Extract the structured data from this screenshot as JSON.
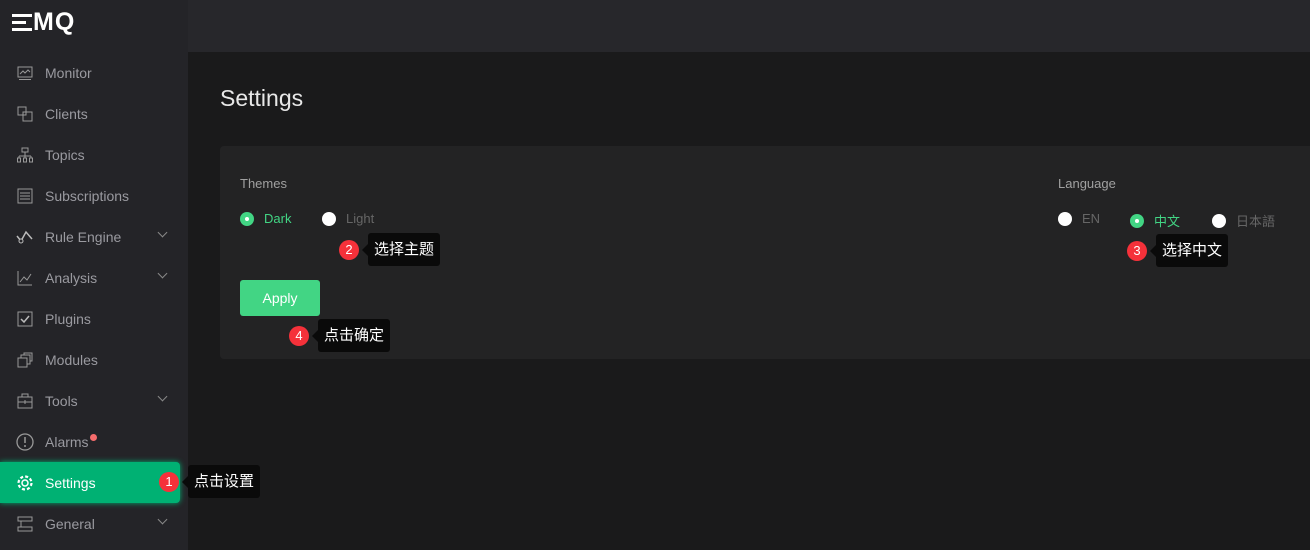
{
  "brand": {
    "logo": "EMQ"
  },
  "sidebar": {
    "items": [
      {
        "label": "Monitor",
        "icon": "monitor-icon"
      },
      {
        "label": "Clients",
        "icon": "clients-icon"
      },
      {
        "label": "Topics",
        "icon": "topics-icon"
      },
      {
        "label": "Subscriptions",
        "icon": "subscriptions-icon"
      },
      {
        "label": "Rule Engine",
        "icon": "rule-engine-icon",
        "expandable": true
      },
      {
        "label": "Analysis",
        "icon": "analysis-icon",
        "expandable": true
      },
      {
        "label": "Plugins",
        "icon": "plugins-icon"
      },
      {
        "label": "Modules",
        "icon": "modules-icon"
      },
      {
        "label": "Tools",
        "icon": "tools-icon",
        "expandable": true
      },
      {
        "label": "Alarms",
        "icon": "alarm-icon",
        "notification_dot": true
      },
      {
        "label": "Settings",
        "icon": "gear-icon",
        "active": true
      },
      {
        "label": "General",
        "icon": "general-icon",
        "expandable": true
      }
    ]
  },
  "page": {
    "title": "Settings"
  },
  "themes": {
    "label": "Themes",
    "options": [
      "Dark",
      "Light"
    ],
    "selected": "Dark"
  },
  "language": {
    "label": "Language",
    "options": [
      "EN",
      "中文",
      "日本語"
    ],
    "selected": "中文"
  },
  "apply_label": "Apply",
  "callouts": [
    {
      "number": "1",
      "text": "点击设置"
    },
    {
      "number": "2",
      "text": "选择主题"
    },
    {
      "number": "3",
      "text": "选择中文"
    },
    {
      "number": "4",
      "text": "点击确定"
    }
  ],
  "colors": {
    "accent": "#42d584",
    "active_menu": "#00b173",
    "badge": "#f5313a"
  }
}
